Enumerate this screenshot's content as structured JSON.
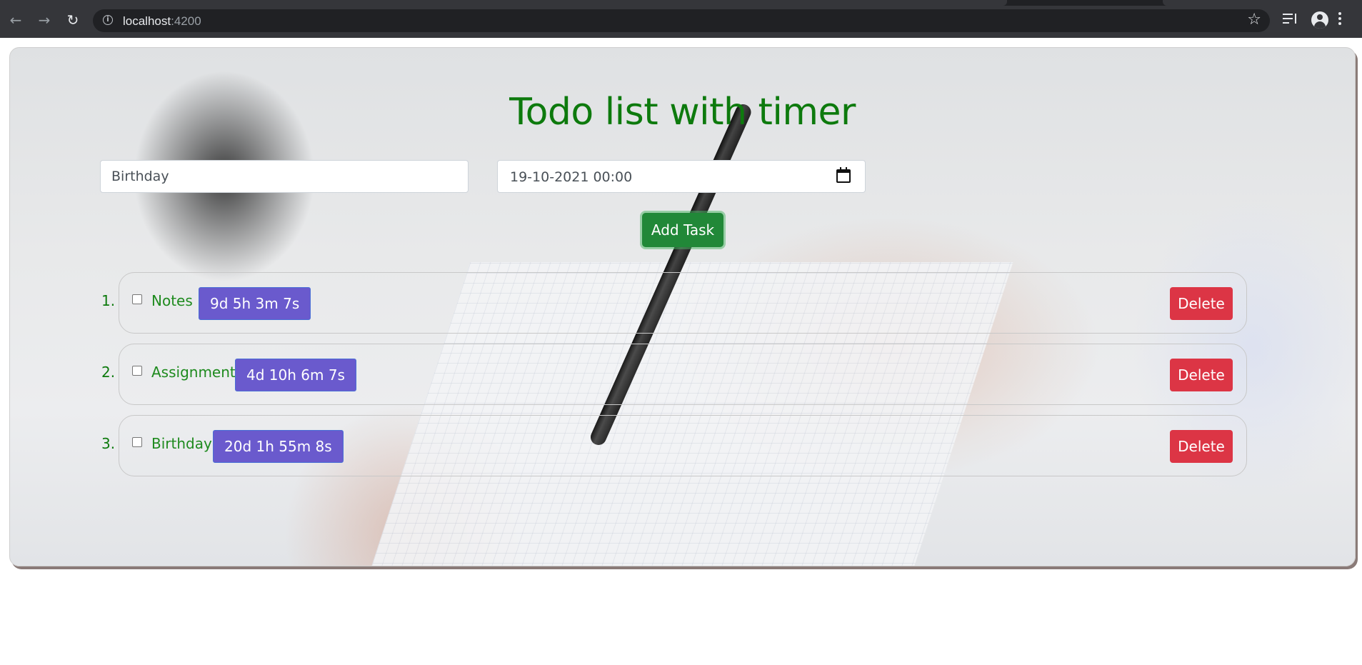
{
  "browser": {
    "url_host": "localhost",
    "url_port": ":4200"
  },
  "app": {
    "title": "Todo list with timer",
    "task_input_value": "Birthday",
    "date_input_value": "19-10-2021 00:00",
    "add_button_label": "Add Task",
    "tasks": [
      {
        "number": "1.",
        "name": "Notes",
        "timer": "9d 5h 3m 7s",
        "delete_label": "Delete",
        "checked": false
      },
      {
        "number": "2.",
        "name": "Assignment",
        "timer": "4d 10h 6m 7s",
        "delete_label": "Delete",
        "checked": false
      },
      {
        "number": "3.",
        "name": "Birthday",
        "timer": "20d 1h 55m 8s",
        "delete_label": "Delete",
        "checked": false
      }
    ]
  },
  "colors": {
    "title": "#0d7a0d",
    "add_button": "#218838",
    "timer_badge": "#6a5acd",
    "delete_button": "#dc3545"
  }
}
